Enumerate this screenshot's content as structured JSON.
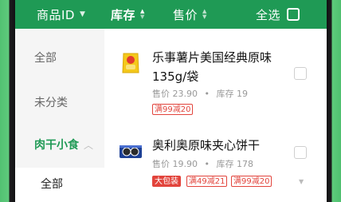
{
  "header": {
    "product_id": "商品ID",
    "stock": "库存",
    "price": "售价",
    "select_all": "全选",
    "accent_color": "#1f9a55"
  },
  "sidebar": {
    "items": [
      {
        "label": "全部"
      },
      {
        "label": "未分类"
      },
      {
        "label": "肉干小食"
      }
    ],
    "sub_item": "全部"
  },
  "products": [
    {
      "name_line1": "乐事薯片美国经典原味",
      "name_line2": "135g/袋",
      "price_label": "售价 23.90",
      "stock_label": "库存 19",
      "tags": [
        "满99减20"
      ],
      "icon": "chips-bag-icon"
    },
    {
      "name_line1": "奥利奥原味夹心饼干",
      "price_label": "售价 19.90",
      "stock_label": "库存 178",
      "tags": [
        "大包装",
        "满49减21",
        "满99减20"
      ],
      "icon": "cookie-box-icon"
    }
  ],
  "separator": "•"
}
